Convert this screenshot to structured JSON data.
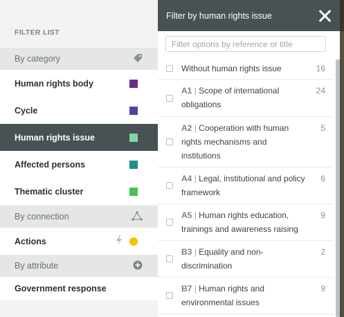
{
  "sidebar": {
    "heading": "FILTER LIST",
    "groups": {
      "category": {
        "label": "By category",
        "icon": "tag-icon"
      },
      "connection": {
        "label": "By connection",
        "icon": "network-icon"
      },
      "attribute": {
        "label": "By attribute",
        "icon": "plus-circle-icon"
      }
    },
    "items": [
      {
        "label": "Human rights body",
        "color": "#6a2a8a"
      },
      {
        "label": "Cycle",
        "color": "#4b44a8"
      },
      {
        "label": "Human rights issue",
        "color": "#7ed9a8",
        "active": true
      },
      {
        "label": "Affected persons",
        "color": "#1e8f8a"
      },
      {
        "label": "Thematic cluster",
        "color": "#4cc04c"
      }
    ],
    "actions": {
      "label": "Actions",
      "icon": "lightning-icon",
      "dot_color": "#f6c000"
    },
    "government_response": {
      "label": "Government response"
    }
  },
  "panel": {
    "title": "Filter by human rights issue",
    "close_icon": "close-icon",
    "search_placeholder": "Filter options by reference or title",
    "options": [
      {
        "ref": "",
        "title": "Without human rights issue",
        "count": "16"
      },
      {
        "ref": "A1",
        "title": "Scope of international obligations",
        "count": "24"
      },
      {
        "ref": "A2",
        "title": "Cooperation with human rights mechanisms and institutions",
        "count": "5"
      },
      {
        "ref": "A4",
        "title": "Legal, institutional and policy framework",
        "count": "6"
      },
      {
        "ref": "A5",
        "title": "Human rights education, trainings and awareness raising",
        "count": "9"
      },
      {
        "ref": "B3",
        "title": "Equality and non-discrimination",
        "count": "2"
      },
      {
        "ref": "B7",
        "title": "Human rights and environmental issues",
        "count": "9"
      }
    ]
  }
}
